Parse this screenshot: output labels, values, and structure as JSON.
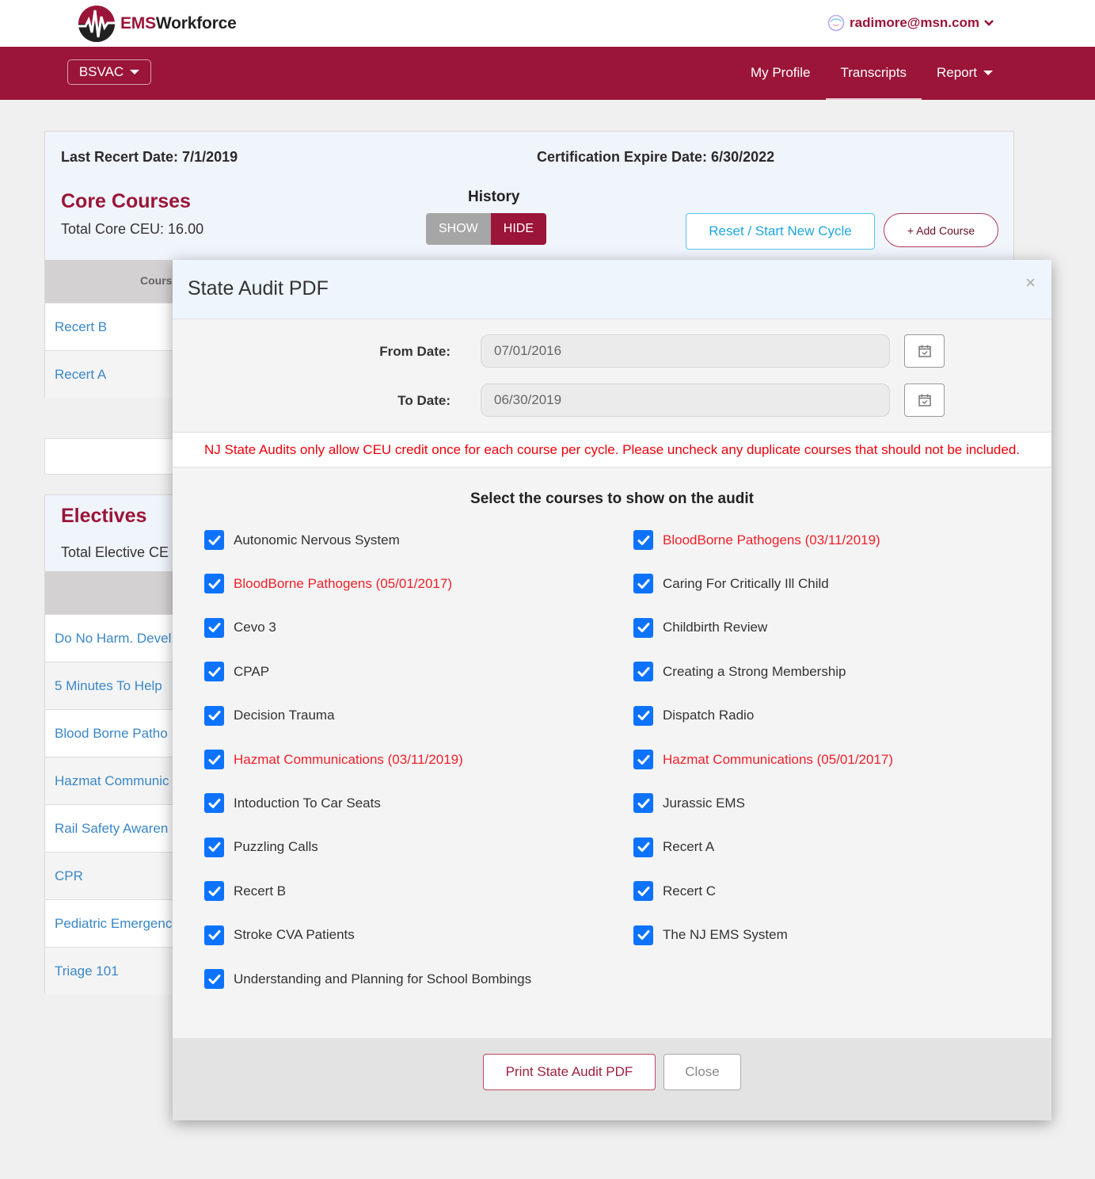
{
  "brand": {
    "ems": "EMS",
    "workforce": "Workforce",
    "primary_color": "#9a1538"
  },
  "user": {
    "email": "radimore@msn.com",
    "chevron": "⌄"
  },
  "nav": {
    "org_selector": "BSVAC",
    "links": [
      {
        "label": "My Profile",
        "active": false
      },
      {
        "label": "Transcripts",
        "active": true
      },
      {
        "label": "Report",
        "active": false
      }
    ]
  },
  "core": {
    "last_recert": "Last Recert Date: 7/1/2019",
    "cert_expire": "Certification Expire Date: 6/30/2022",
    "title": "Core Courses",
    "total": "Total Core CEU: 16.00",
    "history_label": "History",
    "history_show": "SHOW",
    "history_hide": "HIDE",
    "reset_button": "Reset / Start New Cycle",
    "add_button": "+ Add Course",
    "table_header": "Cours",
    "rows": [
      "Recert B",
      "Recert A"
    ]
  },
  "electives": {
    "title": "Electives",
    "total": "Total Elective CE",
    "rows": [
      "Do No Harm. Devel",
      "5 Minutes To Help",
      "Blood Borne Patho",
      "Hazmat Communic",
      "Rail Safety Awaren",
      "CPR",
      "Pediatric Emergenc",
      "Triage 101"
    ]
  },
  "modal": {
    "title": "State Audit PDF",
    "close_icon": "×",
    "from_label": "From Date:",
    "from_value": "07/01/2016",
    "to_label": "To Date:",
    "to_value": "06/30/2019",
    "warning": "NJ State Audits only allow CEU credit once for each course per cycle. Please uncheck any duplicate courses that should not be included.",
    "warning_color": "#f0000a",
    "select_title": "Select the courses to show on the audit",
    "courses_left": [
      {
        "label": "Autonomic Nervous System",
        "checked": true,
        "duplicate": false
      },
      {
        "label": "BloodBorne Pathogens (05/01/2017)",
        "checked": true,
        "duplicate": true
      },
      {
        "label": "Cevo 3",
        "checked": true,
        "duplicate": false
      },
      {
        "label": "CPAP",
        "checked": true,
        "duplicate": false
      },
      {
        "label": "Decision Trauma",
        "checked": true,
        "duplicate": false
      },
      {
        "label": "Hazmat Communications (03/11/2019)",
        "checked": true,
        "duplicate": true
      },
      {
        "label": "Intoduction To Car Seats",
        "checked": true,
        "duplicate": false
      },
      {
        "label": "Puzzling Calls",
        "checked": true,
        "duplicate": false
      },
      {
        "label": "Recert B",
        "checked": true,
        "duplicate": false
      },
      {
        "label": "Stroke CVA Patients",
        "checked": true,
        "duplicate": false
      },
      {
        "label": "Understanding and Planning for School Bombings",
        "checked": true,
        "duplicate": false
      }
    ],
    "courses_right": [
      {
        "label": "BloodBorne Pathogens (03/11/2019)",
        "checked": true,
        "duplicate": true
      },
      {
        "label": "Caring For Critically Ill Child",
        "checked": true,
        "duplicate": false
      },
      {
        "label": "Childbirth Review",
        "checked": true,
        "duplicate": false
      },
      {
        "label": "Creating a Strong Membership",
        "checked": true,
        "duplicate": false
      },
      {
        "label": "Dispatch Radio",
        "checked": true,
        "duplicate": false
      },
      {
        "label": "Hazmat Communications (05/01/2017)",
        "checked": true,
        "duplicate": true
      },
      {
        "label": "Jurassic EMS",
        "checked": true,
        "duplicate": false
      },
      {
        "label": "Recert A",
        "checked": true,
        "duplicate": false
      },
      {
        "label": "Recert C",
        "checked": true,
        "duplicate": false
      },
      {
        "label": "The NJ EMS System",
        "checked": true,
        "duplicate": false
      }
    ],
    "print_button": "Print State Audit PDF",
    "close_button": "Close"
  }
}
